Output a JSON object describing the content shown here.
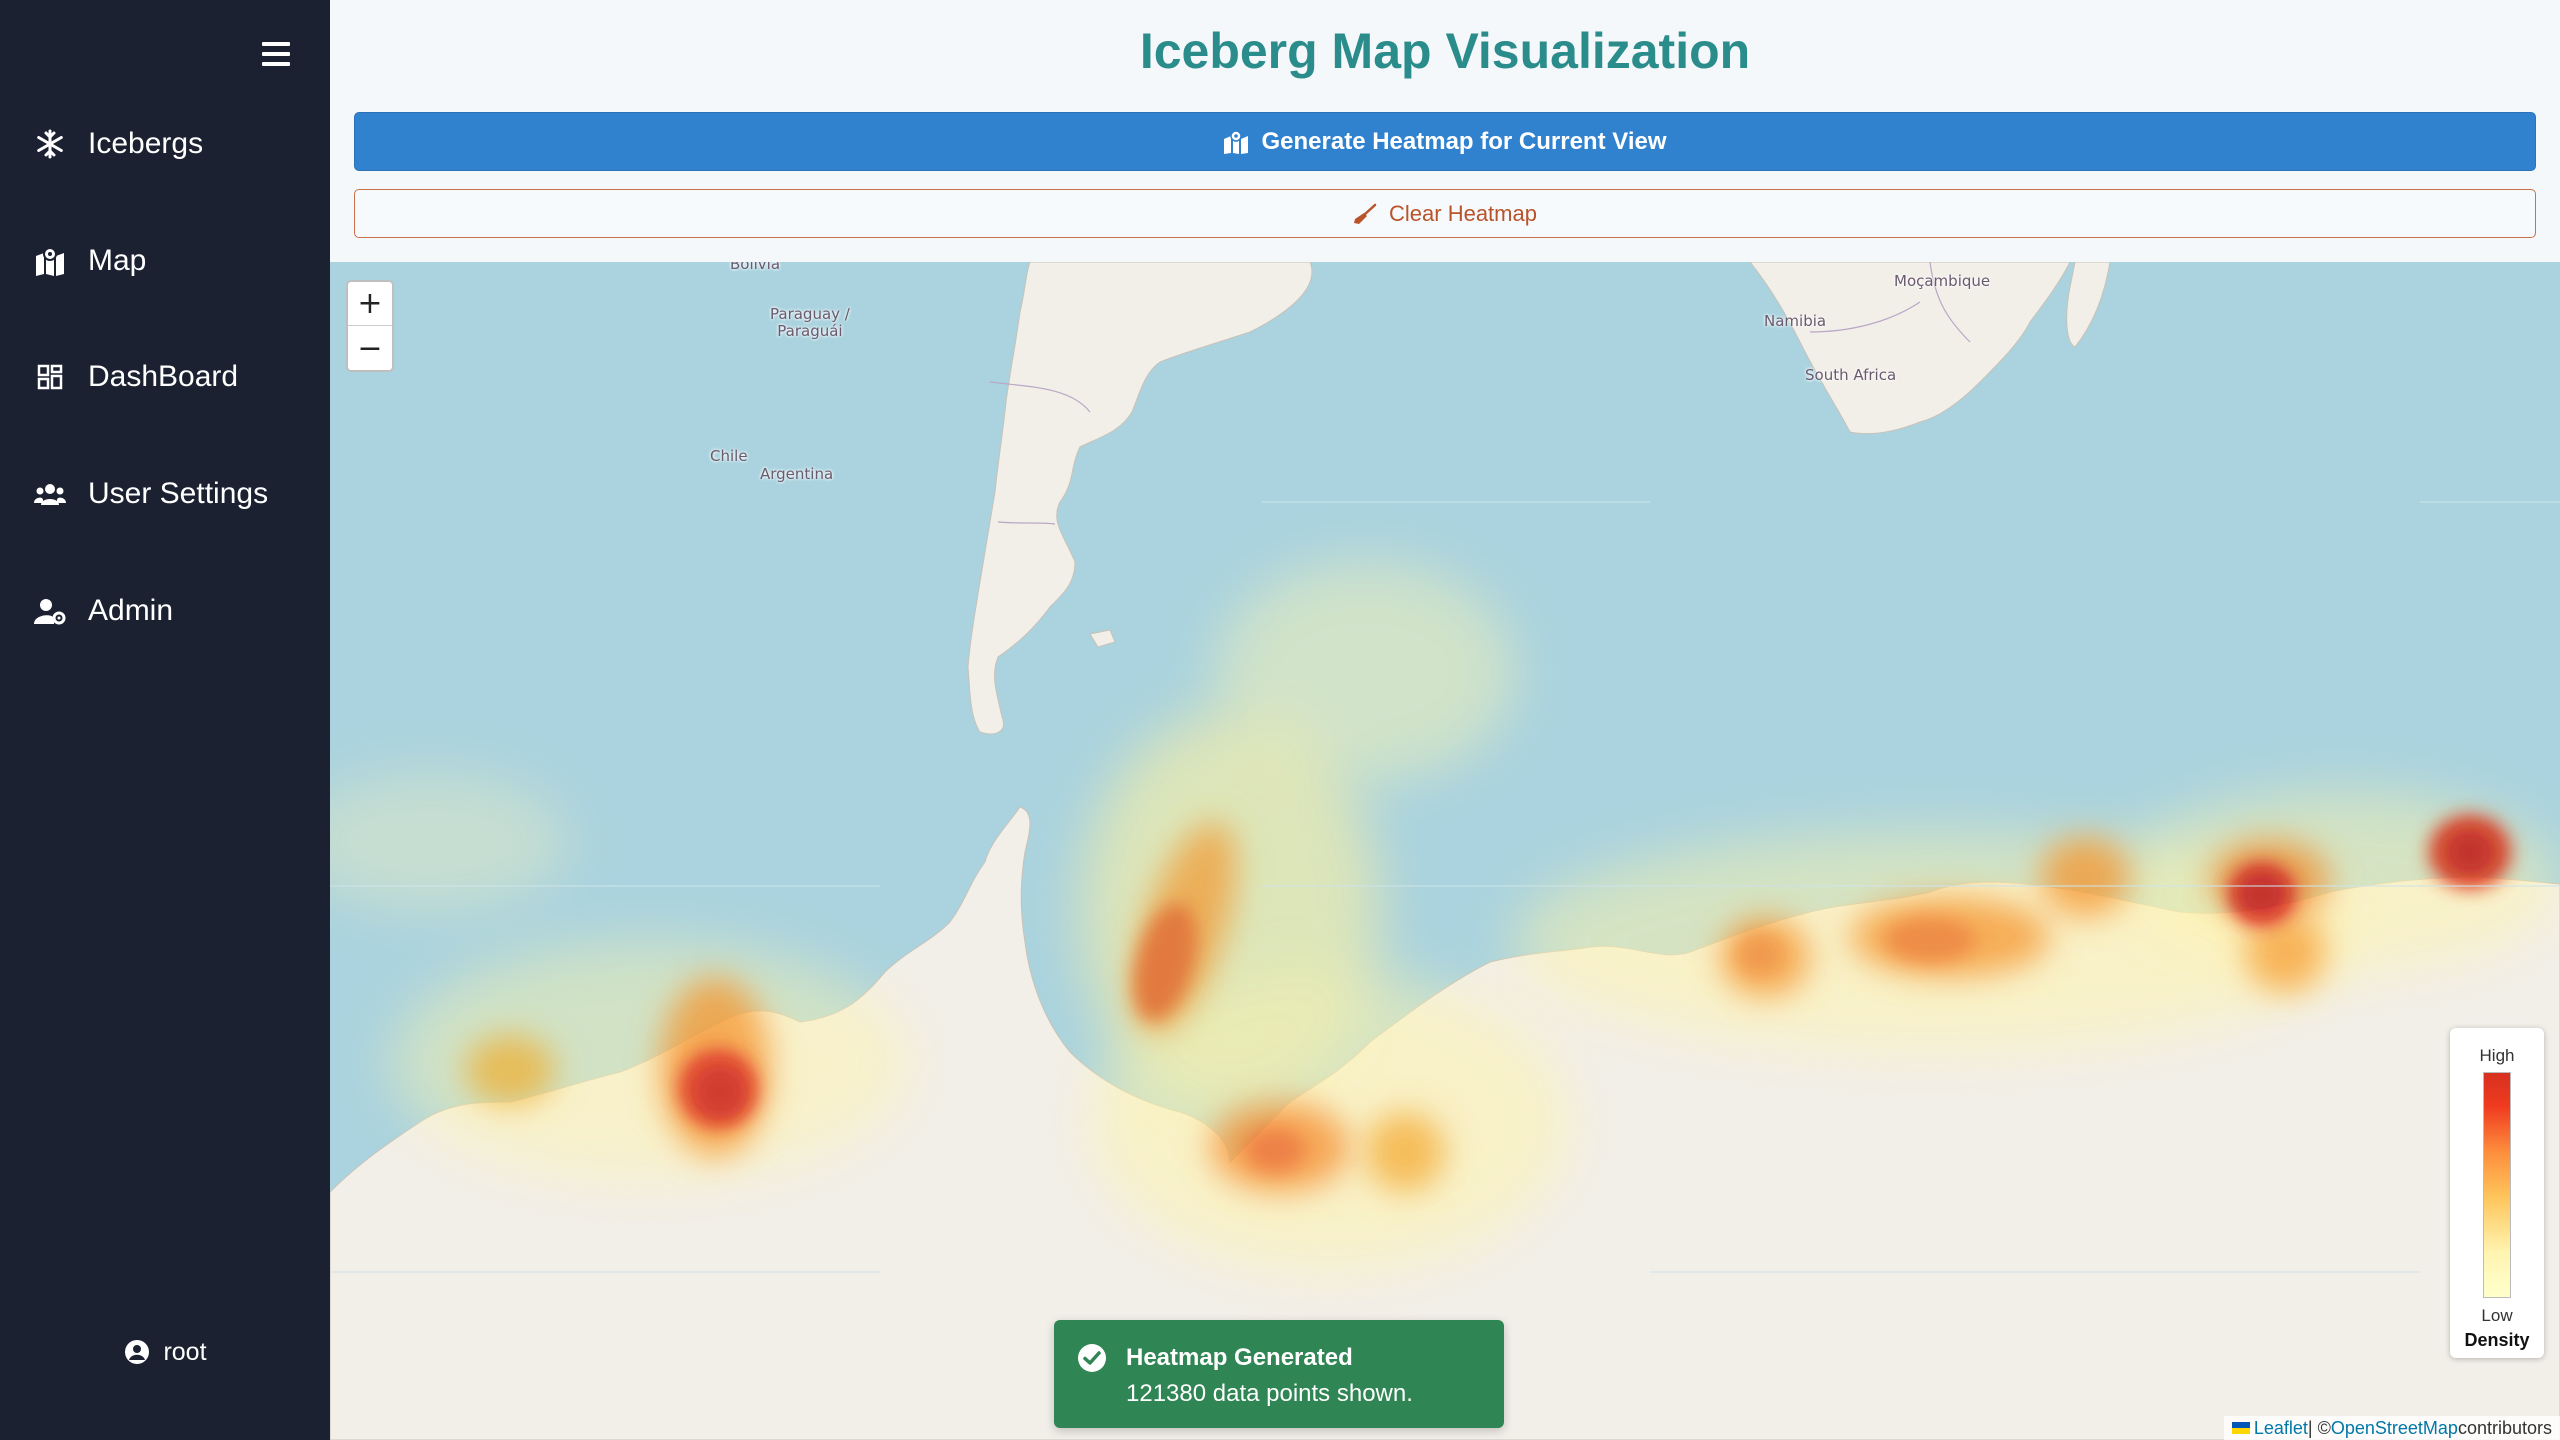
{
  "sidebar": {
    "items": [
      {
        "label": "Icebergs",
        "icon": "snowflake-icon"
      },
      {
        "label": "Map",
        "icon": "map-icon"
      },
      {
        "label": "DashBoard",
        "icon": "dashboard-grid-icon"
      },
      {
        "label": "User Settings",
        "icon": "users-icon"
      },
      {
        "label": "Admin",
        "icon": "user-cog-icon"
      }
    ],
    "user": {
      "label": "root",
      "icon": "user-avatar-icon"
    }
  },
  "header": {
    "title": "Iceberg Map Visualization",
    "generate_label": "Generate Heatmap for Current View",
    "clear_label": "Clear Heatmap"
  },
  "map": {
    "zoom_in": "+",
    "zoom_out": "−",
    "labels": {
      "bolivia": "Bolivia",
      "paraguay": "Paraguay /\nParaguái",
      "chile": "Chile",
      "argentina": "Argentina",
      "namibia": "Namibia",
      "mocambique": "Moçambique",
      "south_africa": "South Africa"
    },
    "legend": {
      "high": "High",
      "low": "Low",
      "title": "Density"
    },
    "attribution": {
      "leaflet": "Leaflet",
      "separator": " | © ",
      "osm": "OpenStreetMap",
      "contributors": " contributors"
    }
  },
  "toast": {
    "title": "Heatmap Generated",
    "body": "121380 data points shown."
  },
  "colors": {
    "sidebar_bg": "#1b2130",
    "title": "#2b8c8c",
    "primary": "#3182ce",
    "clear": "#b8532a",
    "success": "#2f8553",
    "ocean": "#aad3df",
    "land": "#f2efe9"
  }
}
